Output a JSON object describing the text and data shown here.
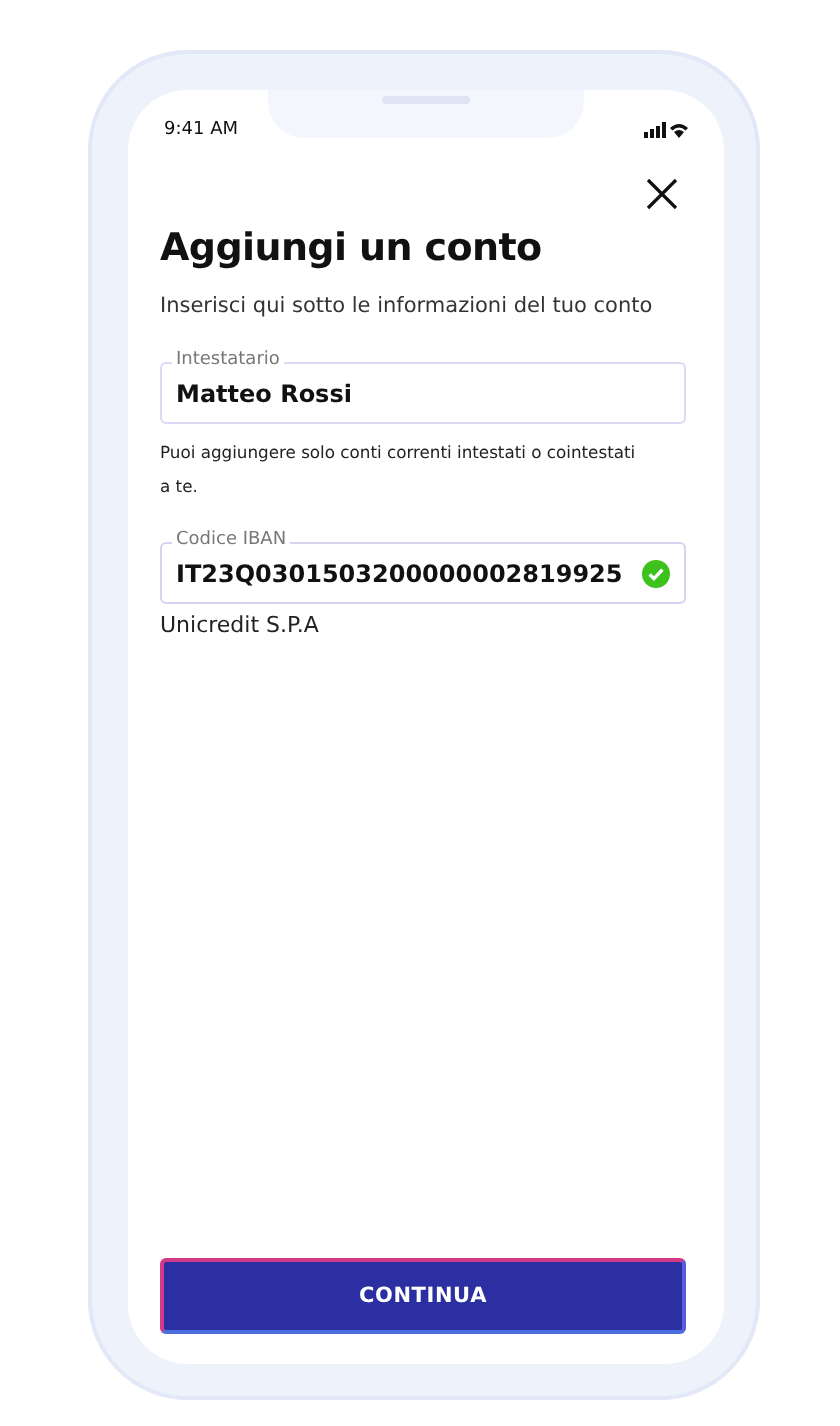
{
  "status_bar": {
    "time": "9:41 AM"
  },
  "title": "Aggiungi un conto",
  "subtitle": "Inserisci qui sotto le informazioni del tuo conto",
  "fields": [
    {
      "label": "Intestatario",
      "value": "Matteo Rossi",
      "valid": false,
      "hint": "Puoi aggiungere solo conti correnti intestati o cointestati a te."
    },
    {
      "label": "Codice IBAN",
      "value": "IT23Q0301503200000002819925",
      "valid": true,
      "hint": "Unicredit S.P.A"
    }
  ],
  "button": "CONTINUA"
}
